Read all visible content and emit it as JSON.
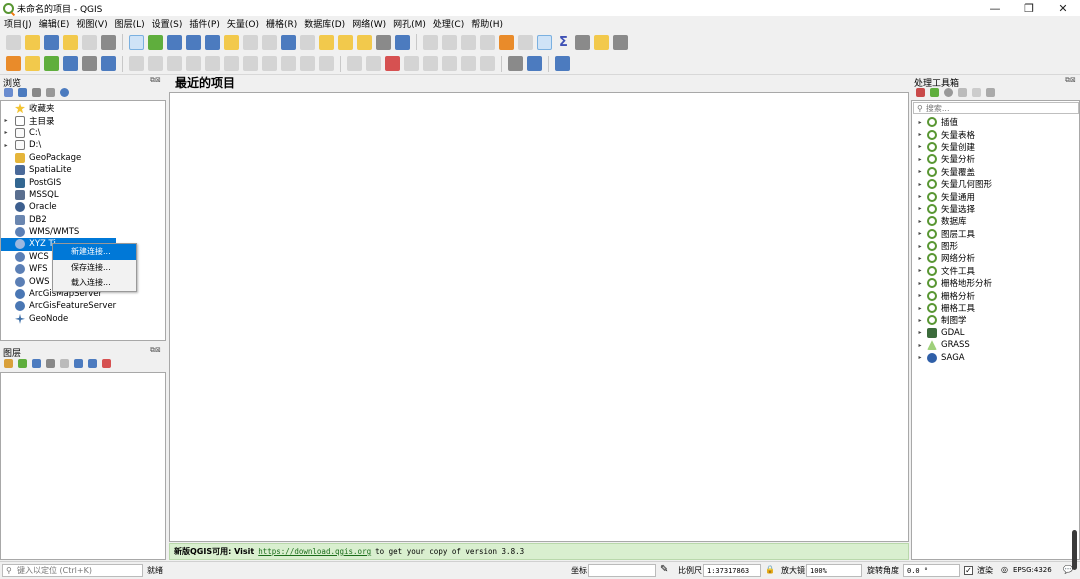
{
  "window": {
    "title": "未命名的项目 - QGIS",
    "controls": [
      "—",
      "❐",
      "✕"
    ]
  },
  "menubar": [
    "项目(J)",
    "编辑(E)",
    "视图(V)",
    "图层(L)",
    "设置(S)",
    "插件(P)",
    "矢量(O)",
    "栅格(R)",
    "数据库(D)",
    "网络(W)",
    "网孔(M)",
    "处理(C)",
    "帮助(H)"
  ],
  "browser": {
    "title": "浏览",
    "items": [
      {
        "label": "收藏夹",
        "icon": "star-icon",
        "expand": ""
      },
      {
        "label": "主目录",
        "icon": "home-folder-icon",
        "expand": "▸"
      },
      {
        "label": "C:\\",
        "icon": "drive-icon",
        "expand": "▸"
      },
      {
        "label": "D:\\",
        "icon": "drive-icon",
        "expand": "▸"
      },
      {
        "label": "GeoPackage",
        "icon": "geopackage-icon",
        "expand": ""
      },
      {
        "label": "SpatiaLite",
        "icon": "spatialite-icon",
        "expand": ""
      },
      {
        "label": "PostGIS",
        "icon": "postgis-icon",
        "expand": ""
      },
      {
        "label": "MSSQL",
        "icon": "mssql-icon",
        "expand": ""
      },
      {
        "label": "Oracle",
        "icon": "oracle-icon",
        "expand": ""
      },
      {
        "label": "DB2",
        "icon": "db2-icon",
        "expand": ""
      },
      {
        "label": "WMS/WMTS",
        "icon": "globe-icon",
        "expand": ""
      },
      {
        "label": "XYZ Ti",
        "icon": "globe-icon",
        "expand": ""
      },
      {
        "label": "WCS",
        "icon": "globe-icon",
        "expand": ""
      },
      {
        "label": "WFS",
        "icon": "globe-icon",
        "expand": ""
      },
      {
        "label": "OWS",
        "icon": "globe-icon",
        "expand": ""
      },
      {
        "label": "ArcGisMapServer",
        "icon": "arcgis-icon",
        "expand": ""
      },
      {
        "label": "ArcGisFeatureServer",
        "icon": "arcgis-icon",
        "expand": ""
      },
      {
        "label": "GeoNode",
        "icon": "geonode-icon",
        "expand": ""
      }
    ],
    "context_menu": [
      "新建连接...",
      "保存连接...",
      "载入连接..."
    ]
  },
  "layers": {
    "title": "图层"
  },
  "main": {
    "heading": "最近的项目",
    "news_prefix": "新版QGIS可用: Visit",
    "news_link": "https://download.qgis.org",
    "news_suffix": "to get your copy of version 3.8.3"
  },
  "toolbox": {
    "title": "处理工具箱",
    "search_placeholder": "搜索...",
    "items": [
      {
        "label": "插值",
        "icon": "qgis"
      },
      {
        "label": "矢量表格",
        "icon": "qgis"
      },
      {
        "label": "矢量创建",
        "icon": "qgis"
      },
      {
        "label": "矢量分析",
        "icon": "qgis"
      },
      {
        "label": "矢量覆盖",
        "icon": "qgis"
      },
      {
        "label": "矢量几何图形",
        "icon": "qgis"
      },
      {
        "label": "矢量通用",
        "icon": "qgis"
      },
      {
        "label": "矢量选择",
        "icon": "qgis"
      },
      {
        "label": "数据库",
        "icon": "qgis"
      },
      {
        "label": "图层工具",
        "icon": "qgis"
      },
      {
        "label": "图形",
        "icon": "qgis"
      },
      {
        "label": "网络分析",
        "icon": "qgis"
      },
      {
        "label": "文件工具",
        "icon": "qgis"
      },
      {
        "label": "栅格地形分析",
        "icon": "qgis"
      },
      {
        "label": "栅格分析",
        "icon": "qgis"
      },
      {
        "label": "栅格工具",
        "icon": "qgis"
      },
      {
        "label": "制图学",
        "icon": "qgis"
      },
      {
        "label": "GDAL",
        "icon": "gdal"
      },
      {
        "label": "GRASS",
        "icon": "grass"
      },
      {
        "label": "SAGA",
        "icon": "saga"
      }
    ]
  },
  "statusbar": {
    "locator_placeholder": "键入以定位 (Ctrl+K)",
    "ready": "就绪",
    "coord_label": "坐标",
    "coord_value": "",
    "scale_label": "比例尺",
    "scale_value": "1:37317863",
    "magnifier_label": "放大镜",
    "magnifier_value": "100%",
    "rotation_label": "旋转角度",
    "rotation_value": "0.0 °",
    "render_label": "渲染",
    "crs": "EPSG:4326"
  },
  "colors": {
    "accent": "#0078d7",
    "qgis_green": "#589632",
    "news_bg": "#d9efcf"
  }
}
